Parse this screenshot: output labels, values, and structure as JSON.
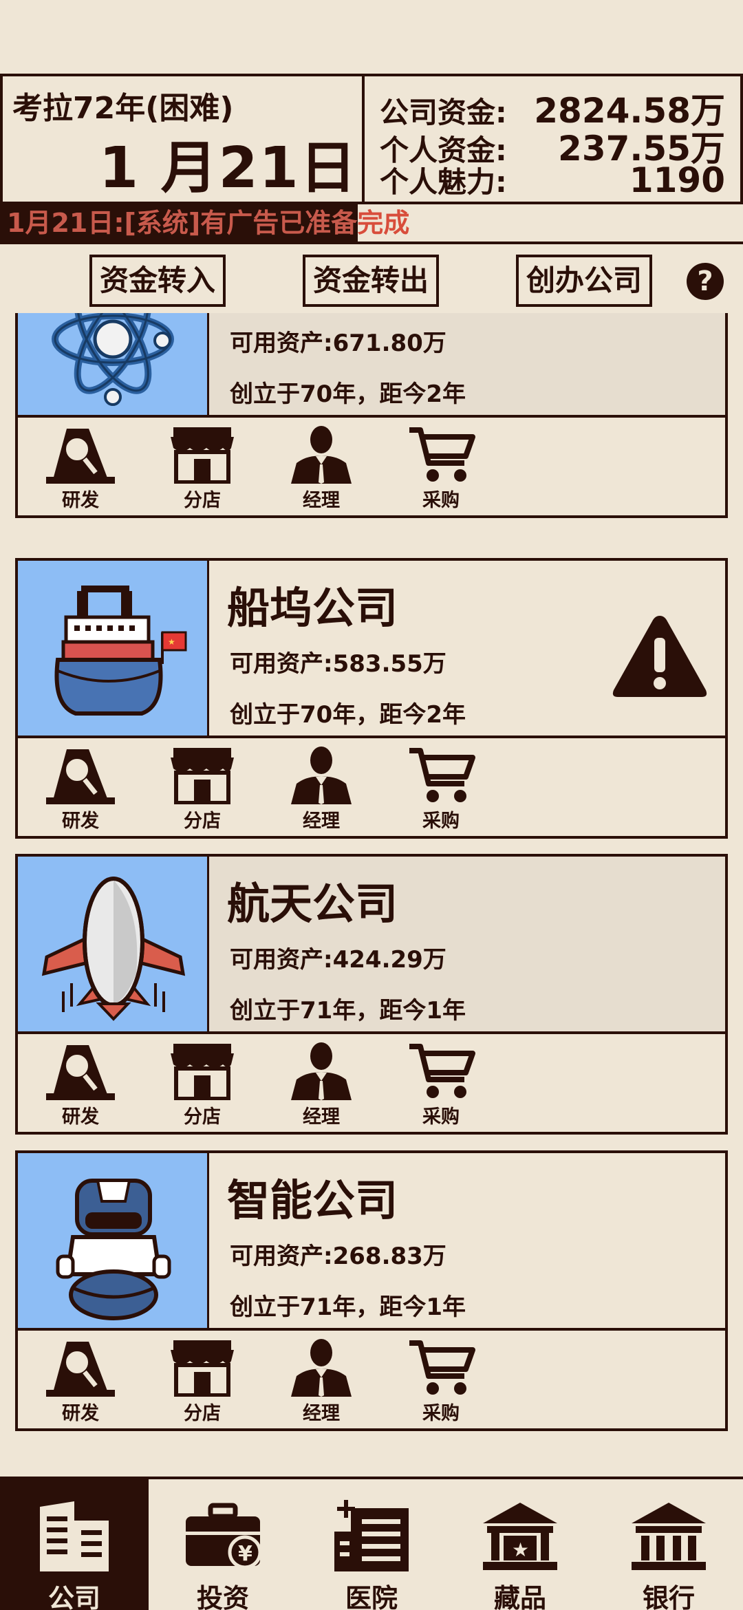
{
  "header": {
    "year_label": "考拉72年(困难)",
    "date_label": "1 月21日",
    "company_funds_label": "公司资金:",
    "company_funds_value": "2824.58万",
    "personal_funds_label": "个人资金:",
    "personal_funds_value": "237.55万",
    "charm_label": "个人魅力:",
    "charm_value": "1190"
  },
  "ticker": {
    "dark_part": "1月21日:[系统]有广告已准备",
    "light_part": "完成"
  },
  "actions": {
    "transfer_in": "资金转入",
    "transfer_out": "资金转出",
    "create_company": "创办公司",
    "help": "?"
  },
  "tools": {
    "research": "研发",
    "branch": "分店",
    "manager": "经理",
    "purchase": "采购"
  },
  "companies": [
    {
      "name": "",
      "assets": "可用资产:671.80万",
      "founded": "创立于70年，距今2年",
      "icon": "atom-icon",
      "warning": false
    },
    {
      "name": "船坞公司",
      "assets": "可用资产:583.55万",
      "founded": "创立于70年，距今2年",
      "icon": "ship-icon",
      "warning": true
    },
    {
      "name": "航天公司",
      "assets": "可用资产:424.29万",
      "founded": "创立于71年，距今1年",
      "icon": "spaceship-icon",
      "warning": false
    },
    {
      "name": "智能公司",
      "assets": "可用资产:268.83万",
      "founded": "创立于71年，距今1年",
      "icon": "robot-icon",
      "warning": false
    }
  ],
  "nav": {
    "company": "公司",
    "invest": "投资",
    "hospital": "医院",
    "collection": "藏品",
    "bank": "银行"
  },
  "colors": {
    "background": "#efe6d6",
    "ink": "#2a0f08",
    "image_blue": "#8dbdf5",
    "ticker_red": "#d84d3b"
  }
}
